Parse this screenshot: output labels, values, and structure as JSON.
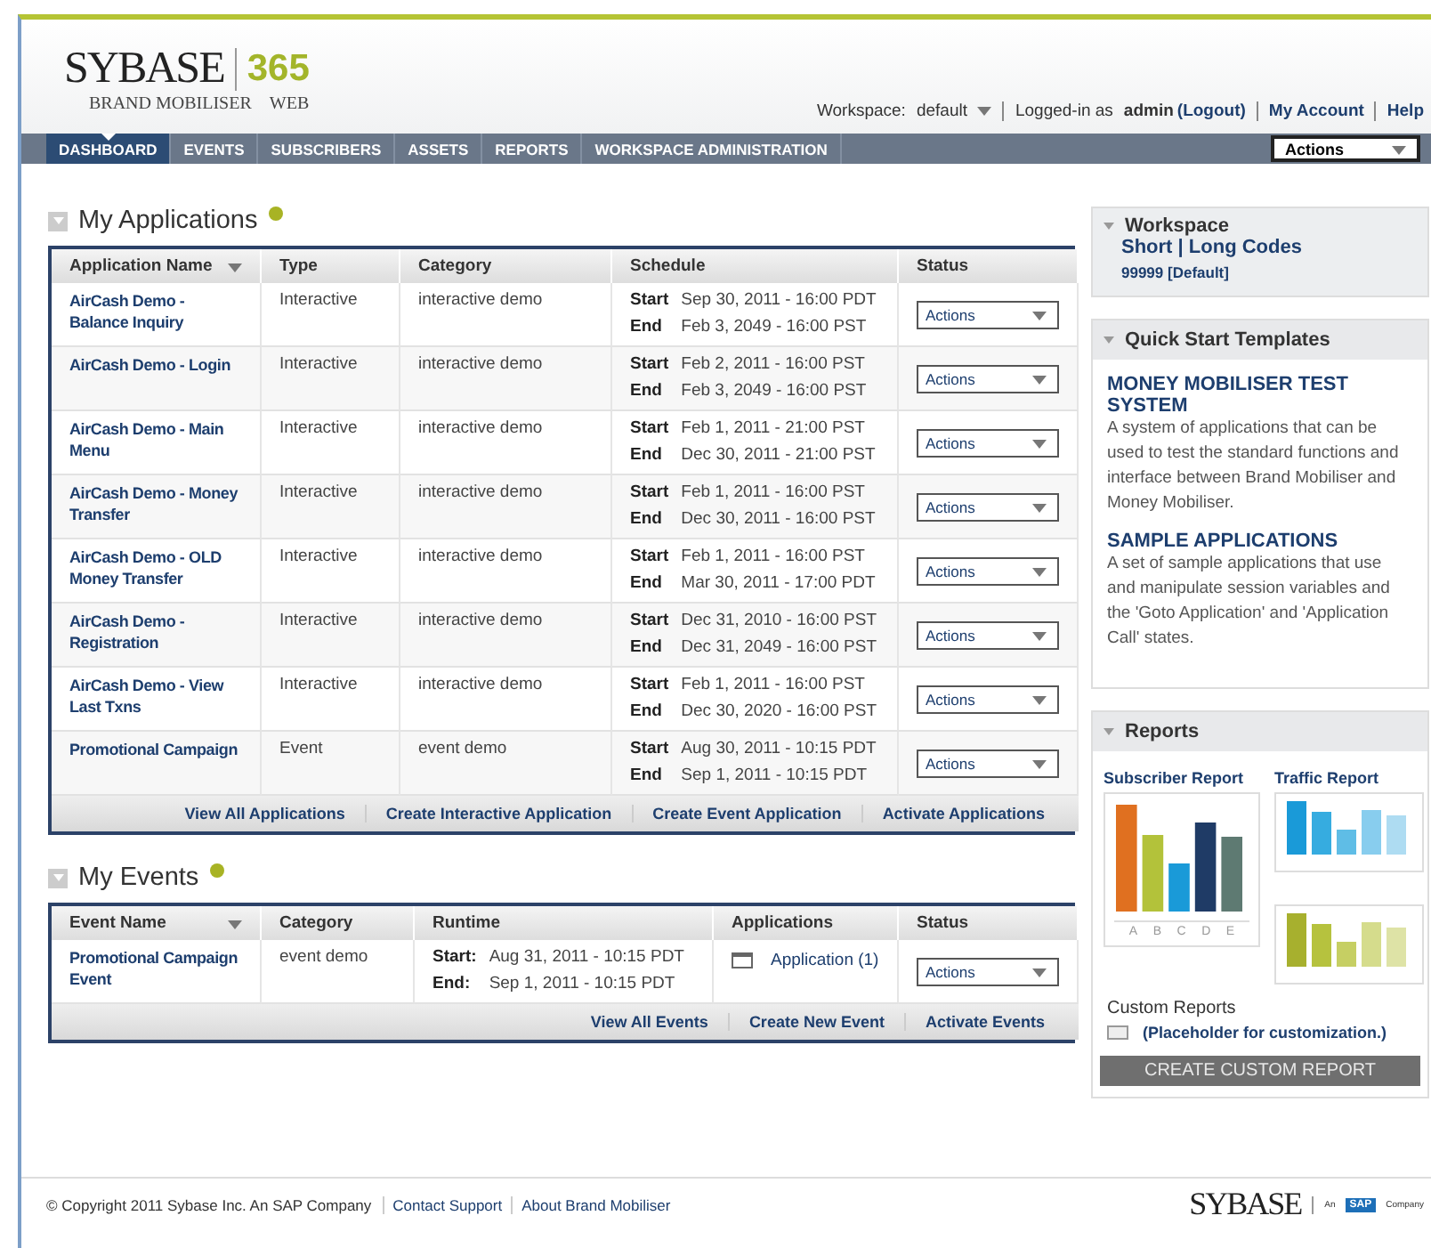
{
  "logo": {
    "brand": "SYBASE",
    "product": "365",
    "subtitle": "BRAND MOBILISER",
    "subtitle_2": "WEB"
  },
  "top_links": {
    "workspace_label": "Workspace:",
    "workspace_value": "default",
    "logged_in": "Logged-in as",
    "user": "admin",
    "logout": "(Logout)",
    "account": "My Account",
    "help": "Help"
  },
  "nav": [
    {
      "label": "DASHBOARD",
      "selected": true
    },
    {
      "label": "EVENTS",
      "selected": false
    },
    {
      "label": "SUBSCRIBERS",
      "selected": false
    },
    {
      "label": "ASSETS",
      "selected": false
    },
    {
      "label": "REPORTS",
      "selected": false
    },
    {
      "label": "WORKSPACE ADMINISTRATION",
      "selected": false
    }
  ],
  "nav_actions": "Actions",
  "applications": {
    "title": "My Applications",
    "columns": [
      "Application Name",
      "Type",
      "Category",
      "Schedule",
      "Status"
    ],
    "rows": [
      {
        "name": "AirCash Demo - Balance Inquiry",
        "type": "Interactive",
        "category": "interactive demo",
        "start_label": "Start",
        "start": "Sep 30, 2011 - 16:00 PDT",
        "end_label": "End",
        "end": "Feb 3, 2049 - 16:00 PST",
        "status": "Actions"
      },
      {
        "name": "AirCash Demo - Login",
        "type": "Interactive",
        "category": "interactive demo",
        "start_label": "Start",
        "start": "Feb 2, 2011 - 16:00 PST",
        "end_label": "End",
        "end": "Feb 3, 2049 - 16:00 PST",
        "status": "Actions"
      },
      {
        "name": "AirCash Demo - Main Menu",
        "type": "Interactive",
        "category": "interactive demo",
        "start_label": "Start",
        "start": "Feb 1, 2011 - 21:00 PST",
        "end_label": "End",
        "end": "Dec 30, 2011 - 21:00 PST",
        "status": "Actions"
      },
      {
        "name": "AirCash Demo - Money Transfer",
        "type": "Interactive",
        "category": "interactive demo",
        "start_label": "Start",
        "start": "Feb 1, 2011 - 16:00 PST",
        "end_label": "End",
        "end": "Dec 30, 2011 - 16:00 PST",
        "status": "Actions"
      },
      {
        "name": "AirCash Demo - OLD Money Transfer",
        "type": "Interactive",
        "category": "interactive demo",
        "start_label": "Start",
        "start": "Feb 1, 2011 - 16:00 PST",
        "end_label": "End",
        "end": "Mar 30, 2011 - 17:00 PDT",
        "status": "Actions"
      },
      {
        "name": "AirCash Demo - Registration",
        "type": "Interactive",
        "category": "interactive demo",
        "start_label": "Start",
        "start": "Dec 31, 2010 - 16:00 PST",
        "end_label": "End",
        "end": "Dec 31, 2049 - 16:00 PST",
        "status": "Actions"
      },
      {
        "name": "AirCash Demo - View Last Txns",
        "type": "Interactive",
        "category": "interactive demo",
        "start_label": "Start",
        "start": "Feb 1, 2011 - 16:00 PST",
        "end_label": "End",
        "end": "Dec 30, 2020 - 16:00 PST",
        "status": "Actions"
      },
      {
        "name": "Promotional Campaign",
        "type": "Event",
        "category": "event demo",
        "start_label": "Start",
        "start": "Aug 30, 2011 - 10:15 PDT",
        "end_label": "End",
        "end": "Sep 1, 2011 - 10:15 PDT",
        "status": "Actions"
      }
    ],
    "links": [
      "View All Applications",
      "Create Interactive Application",
      "Create Event Application",
      "Activate Applications"
    ]
  },
  "events": {
    "title": "My Events",
    "columns": [
      "Event Name",
      "Category",
      "Runtime",
      "Applications",
      "Status"
    ],
    "rows": [
      {
        "name": "Promotional Campaign Event",
        "category": "event demo",
        "start_label": "Start:",
        "start": "Aug 31, 2011 - 10:15 PDT",
        "end_label": "End:",
        "end": "Sep 1, 2011 - 10:15 PDT",
        "application": "Application (1)",
        "status": "Actions"
      }
    ],
    "links": [
      "View All Events",
      "Create New Event",
      "Activate Events"
    ]
  },
  "workspace": {
    "title": "Workspace",
    "codes": "Short | Long Codes",
    "default": "99999 [Default]"
  },
  "templates": {
    "title": "Quick Start Templates",
    "items": [
      {
        "title": "MONEY MOBILISER TEST SYSTEM",
        "text": "A system of applications that can be used to test the standard functions and interface between Brand Mobiliser and Money Mobiliser."
      },
      {
        "title": "SAMPLE APPLICATIONS",
        "text": "A set of sample applications that use and manipulate session variables and the 'Goto Application' and 'Application Call' states."
      }
    ]
  },
  "reports": {
    "title": "Reports",
    "subscriber": "Subscriber Report",
    "subscriber_axis": [
      "A",
      "B",
      "C",
      "D",
      "E"
    ],
    "traffic": "Traffic Report",
    "custom_title": "Custom Reports",
    "custom_placeholder": "(Placeholder for customization.)",
    "create": "CREATE CUSTOM REPORT"
  },
  "footer": {
    "copyright": "© Copyright 2011 Sybase Inc. An SAP Company",
    "links": [
      "Contact Support",
      "About Brand Mobiliser"
    ],
    "logo": "SYBASE",
    "an": "An",
    "sap": "SAP",
    "company": "Company"
  }
}
